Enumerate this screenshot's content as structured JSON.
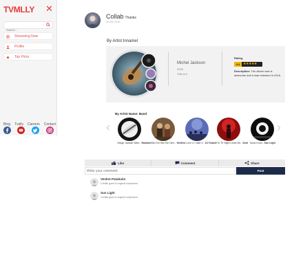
{
  "brand": {
    "logo_text": "TVMLLY",
    "accent": "#e53b3b",
    "dark": "#1d2b4a"
  },
  "sidebar": {
    "search_placeholder": "Search...",
    "nav": [
      {
        "label": "Streaming Now",
        "icon": "radio-icon"
      },
      {
        "label": "Profile",
        "icon": "user-icon"
      },
      {
        "label": "Top Picks",
        "icon": "star-icon"
      }
    ],
    "footer_links": [
      "Blog",
      "Tvally",
      "Careers",
      "Contact"
    ],
    "social": [
      {
        "name": "facebook-icon",
        "color": "#3b5998"
      },
      {
        "name": "youtube-icon",
        "color": "#cd201f"
      },
      {
        "name": "twitter-icon",
        "color": "#1da1f2"
      },
      {
        "name": "instagram-icon",
        "color": "#c13584"
      }
    ]
  },
  "profile": {
    "name": "Collab",
    "subtitle": "Thanks",
    "date": "10-06-2016"
  },
  "album": {
    "section_title": "By Artist Innamel",
    "artist_name": "Michel Jackson",
    "year": "2016",
    "note": "This is it",
    "rating_label": "Rating",
    "rating_value": "4.4",
    "rating_stars": "★★★★★",
    "description_label": "Description:",
    "description_text": "The album was is awesome and it was released in 2016."
  },
  "band_section": {
    "title": "By Artist Name: Band",
    "items": [
      {
        "prefix": "Jhinge Jawaan Wars -",
        "bold": "Random"
      },
      {
        "prefix": "Han Din Han Din Dinn -",
        "bold": "Geethu"
      },
      {
        "prefix": "I Love U I Hate U -",
        "bold": "DJ Snack"
      },
      {
        "prefix": "For Th Night Losist Mo -",
        "bold": "Deal"
      },
      {
        "prefix": "Nuna Kuna -",
        "bold": "Sun Light"
      }
    ]
  },
  "actions": {
    "like": "Like",
    "comment": "Comment",
    "share": "Share"
  },
  "comment_box": {
    "placeholder": "Write your comment",
    "post_label": "Post"
  },
  "comments": [
    {
      "name": "Venkot Patabuits",
      "text": "Credits goes to original composers"
    },
    {
      "name": "Sun Light",
      "text": "Credits goes to original composers"
    }
  ]
}
